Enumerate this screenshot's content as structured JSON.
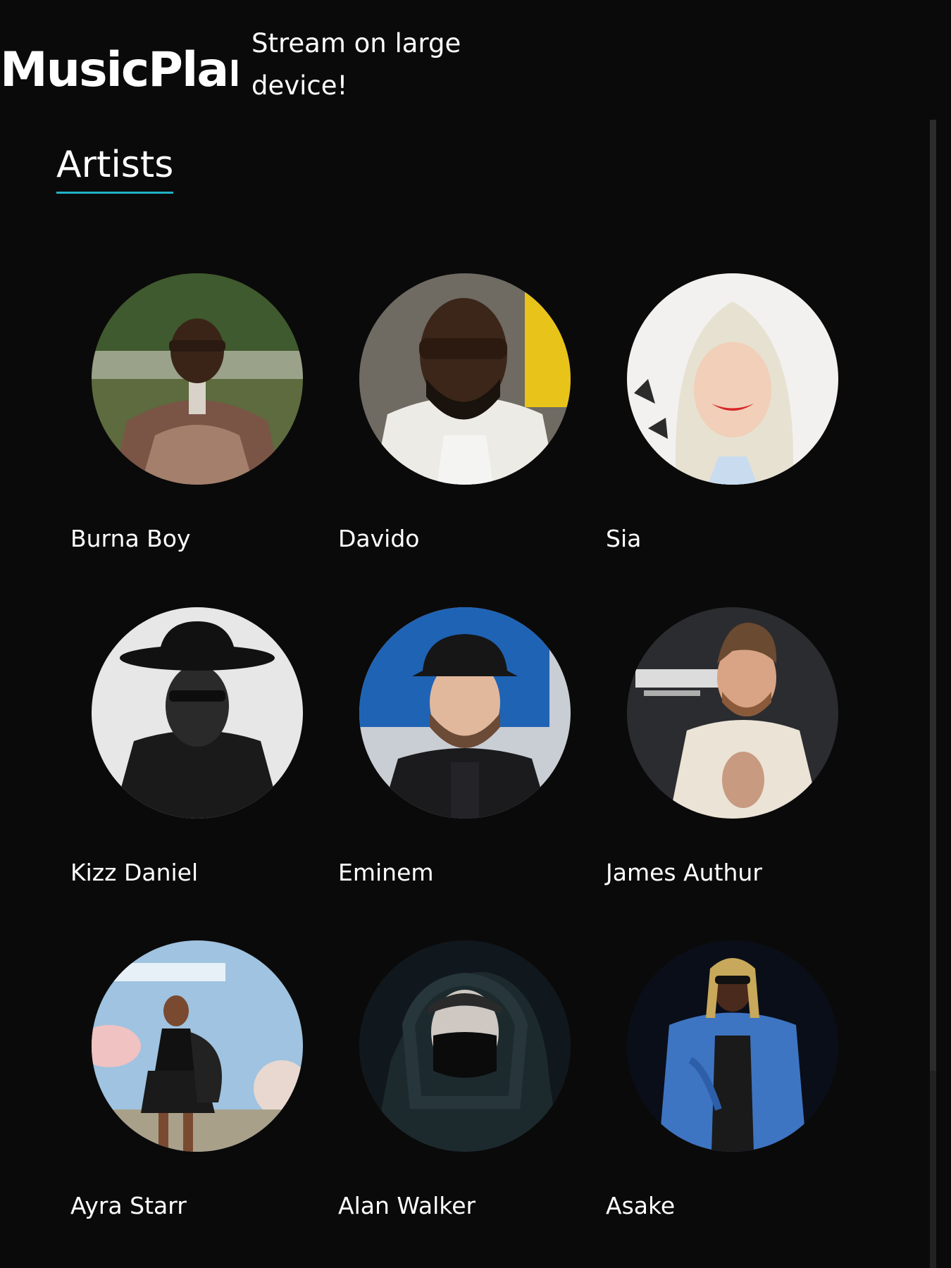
{
  "header": {
    "logo_text": "MusicPlanet",
    "promo_text": "Stream on large device!"
  },
  "main": {
    "heading": "Artists",
    "artists": [
      {
        "name": "Burna Boy"
      },
      {
        "name": "Davido"
      },
      {
        "name": "Sia"
      },
      {
        "name": "Kizz Daniel"
      },
      {
        "name": "Eminem"
      },
      {
        "name": "James Authur"
      },
      {
        "name": "Ayra Starr"
      },
      {
        "name": "Alan Walker"
      },
      {
        "name": "Asake"
      }
    ]
  },
  "colors": {
    "background": "#0b0a0a",
    "text": "#ffffff",
    "accent_underline": "#20b2c8"
  }
}
